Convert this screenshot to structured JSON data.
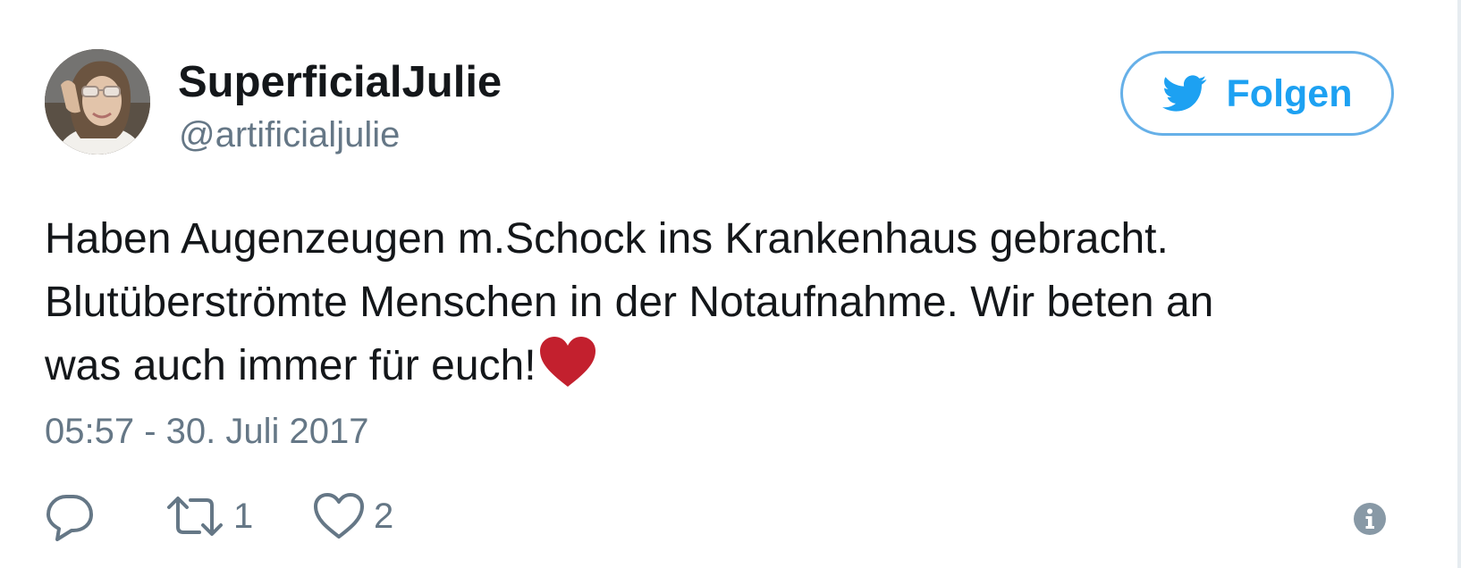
{
  "tweet": {
    "user": {
      "display_name": "SuperficialJulie",
      "handle": "@artificialjulie",
      "avatar_icon": "profile-photo"
    },
    "follow_button": {
      "label": "Folgen",
      "icon": "twitter-bird-icon",
      "color": "#1da1f2"
    },
    "text_lines": [
      "Haben Augenzeugen m.Schock ins Krankenhaus gebracht.",
      "Blutüberströmte Menschen in der Notaufnahme. Wir beten an",
      "was auch immer für euch!"
    ],
    "emoji": "red-heart",
    "timestamp": "05:57 - 30. Juli 2017",
    "actions": {
      "reply": {
        "icon": "reply-icon",
        "count": ""
      },
      "retweet": {
        "icon": "retweet-icon",
        "count": "1"
      },
      "like": {
        "icon": "heart-icon",
        "count": "2"
      },
      "info": {
        "icon": "info-icon"
      }
    }
  }
}
